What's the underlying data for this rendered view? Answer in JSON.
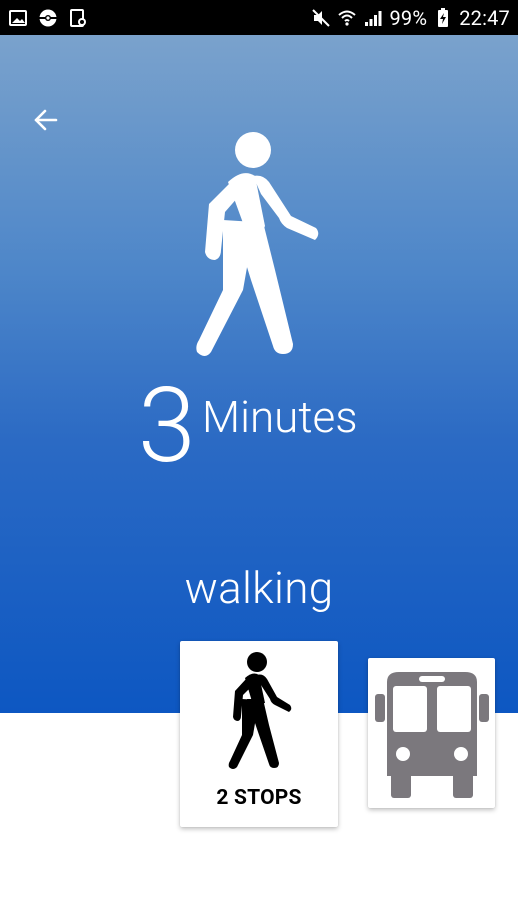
{
  "status_bar": {
    "battery": "99%",
    "time": "22:47",
    "left_icons": [
      "image-icon",
      "pokeball-icon",
      "document-sync-icon"
    ],
    "right_icons": [
      "mute-icon",
      "wifi-icon",
      "signal-icon",
      "battery-charging-icon"
    ]
  },
  "header": {
    "back_icon": "arrow-left-icon"
  },
  "summary": {
    "minutes_value": "3",
    "minutes_unit": "Minutes",
    "mode_label": "walking"
  },
  "steps": [
    {
      "type": "walk",
      "icon": "walking-person-icon",
      "label": "2 STOPS"
    },
    {
      "type": "bus",
      "icon": "bus-icon"
    }
  ],
  "colors": {
    "gradient_top": "#7aa2cc",
    "gradient_bottom": "#0d57c2",
    "bus_icon": "#7b787d"
  }
}
